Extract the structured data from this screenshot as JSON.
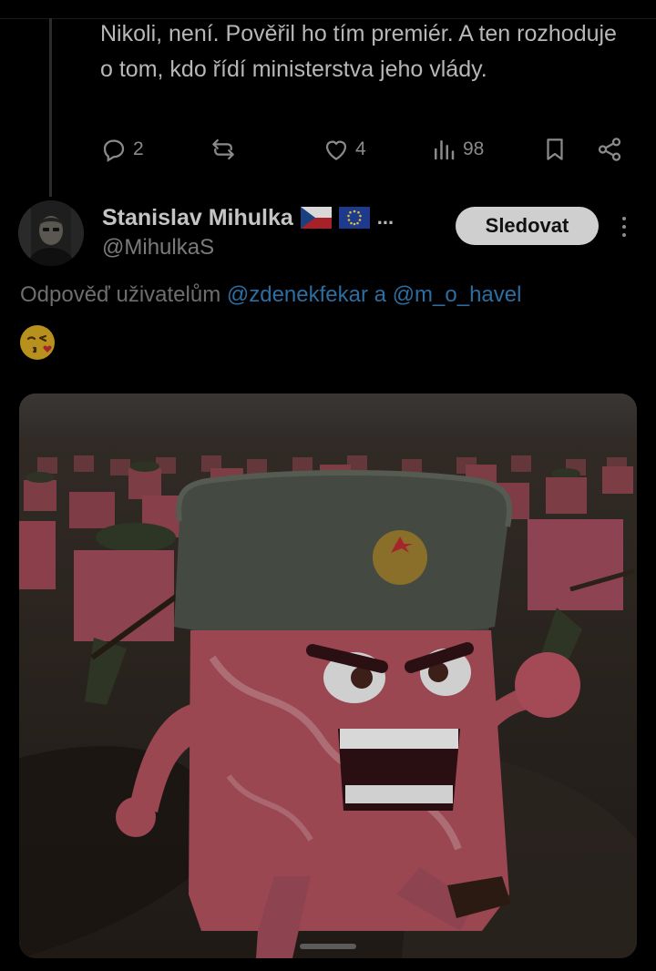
{
  "previous_tweet": {
    "text": "Nikoli, není. Pověřil ho tím premiér. A ten rozhoduje o tom, kdo řídí ministerstva jeho vlády.",
    "actions": {
      "reply_count": "2",
      "retweet_count": "",
      "like_count": "4",
      "view_count": "98"
    }
  },
  "tweet": {
    "author_name": "Stanislav Mihulka",
    "author_name_suffix": "...",
    "handle": "@MihulkaS",
    "follow_label": "Sledovat",
    "reply_prefix": "Odpověď uživatelům",
    "mention_1": "@zdenekfekar",
    "mention_join": "a",
    "mention_2": "@m_o_havel",
    "emoji": "😘"
  },
  "icons": {
    "reply": "reply-icon",
    "retweet": "retweet-icon",
    "like": "heart-icon",
    "views": "views-icon",
    "bookmark": "bookmark-icon",
    "share": "share-icon",
    "more": "more-icon"
  }
}
